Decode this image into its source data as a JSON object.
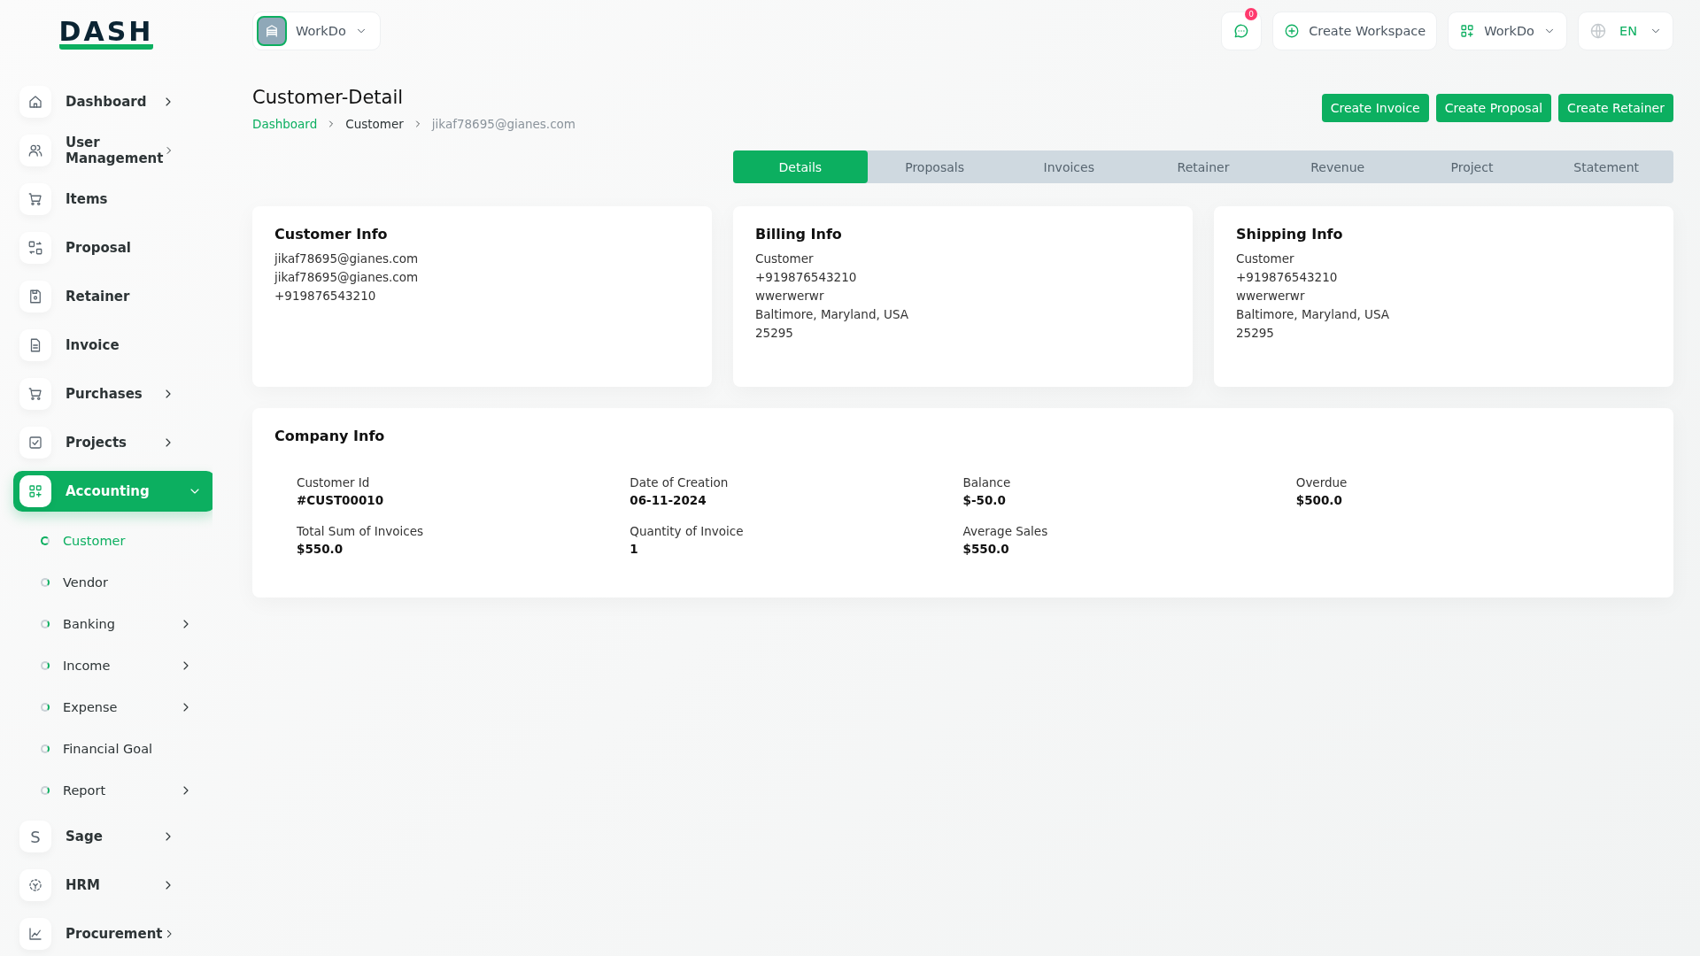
{
  "logo": "DASH",
  "sidebar": {
    "items": [
      {
        "label": "Dashboard",
        "has_submenu": true,
        "expanded": false,
        "selected": false
      },
      {
        "label": "User Management",
        "has_submenu": true,
        "expanded": false,
        "selected": false
      },
      {
        "label": "Items",
        "has_submenu": false,
        "selected": false
      },
      {
        "label": "Proposal",
        "has_submenu": false,
        "selected": false
      },
      {
        "label": "Retainer",
        "has_submenu": false,
        "selected": false
      },
      {
        "label": "Invoice",
        "has_submenu": false,
        "selected": false
      },
      {
        "label": "Purchases",
        "has_submenu": true,
        "expanded": false,
        "selected": false
      },
      {
        "label": "Projects",
        "has_submenu": true,
        "expanded": false,
        "selected": false
      },
      {
        "label": "Accounting",
        "has_submenu": true,
        "expanded": true,
        "selected": true,
        "children": [
          {
            "label": "Customer",
            "has_submenu": false,
            "selected": true
          },
          {
            "label": "Vendor",
            "has_submenu": false,
            "selected": false
          },
          {
            "label": "Banking",
            "has_submenu": true,
            "selected": false
          },
          {
            "label": "Income",
            "has_submenu": true,
            "selected": false
          },
          {
            "label": "Expense",
            "has_submenu": true,
            "selected": false
          },
          {
            "label": "Financial Goal",
            "has_submenu": false,
            "selected": false
          },
          {
            "label": "Report",
            "has_submenu": true,
            "selected": false
          }
        ]
      },
      {
        "label": "Sage",
        "icon_letter": "S",
        "has_submenu": true,
        "expanded": false,
        "selected": false
      },
      {
        "label": "HRM",
        "has_submenu": true,
        "expanded": false,
        "selected": false
      },
      {
        "label": "Procurement",
        "has_submenu": true,
        "expanded": false,
        "selected": false
      }
    ]
  },
  "header": {
    "workspace": "WorkDo",
    "notification_count": "0",
    "create_workspace": "Create Workspace",
    "company": "WorkDo",
    "language": "EN"
  },
  "page": {
    "title": "Customer-Detail",
    "breadcrumb": [
      "Dashboard",
      "Customer",
      "jikaf78695@gianes.com"
    ],
    "actions": [
      "Create Invoice",
      "Create Proposal",
      "Create Retainer"
    ]
  },
  "tabs": [
    {
      "label": "Details",
      "selected": true
    },
    {
      "label": "Proposals",
      "selected": false
    },
    {
      "label": "Invoices",
      "selected": false
    },
    {
      "label": "Retainer",
      "selected": false
    },
    {
      "label": "Revenue",
      "selected": false
    },
    {
      "label": "Project",
      "selected": false
    },
    {
      "label": "Statement",
      "selected": false
    }
  ],
  "info_cards": [
    {
      "title": "Customer Info",
      "lines": [
        "jikaf78695@gianes.com",
        "jikaf78695@gianes.com",
        "+919876543210"
      ]
    },
    {
      "title": "Billing Info",
      "lines": [
        "Customer",
        "+919876543210",
        "wwerwerwr",
        "Baltimore, Maryland, USA",
        "25295"
      ]
    },
    {
      "title": "Shipping Info",
      "lines": [
        "Customer",
        "+919876543210",
        "wwerwerwr",
        "Baltimore, Maryland, USA",
        "25295"
      ]
    }
  ],
  "company_info": {
    "title": "Company Info",
    "fields": [
      {
        "label": "Customer Id",
        "value": "#CUST00010"
      },
      {
        "label": "Date of Creation",
        "value": "06-11-2024"
      },
      {
        "label": "Balance",
        "value": "$-50.0"
      },
      {
        "label": "Overdue",
        "value": "$500.0"
      },
      {
        "label": "Total Sum of Invoices",
        "value": "$550.0"
      },
      {
        "label": "Quantity of Invoice",
        "value": "1"
      },
      {
        "label": "Average Sales",
        "value": "$550.0"
      }
    ]
  }
}
